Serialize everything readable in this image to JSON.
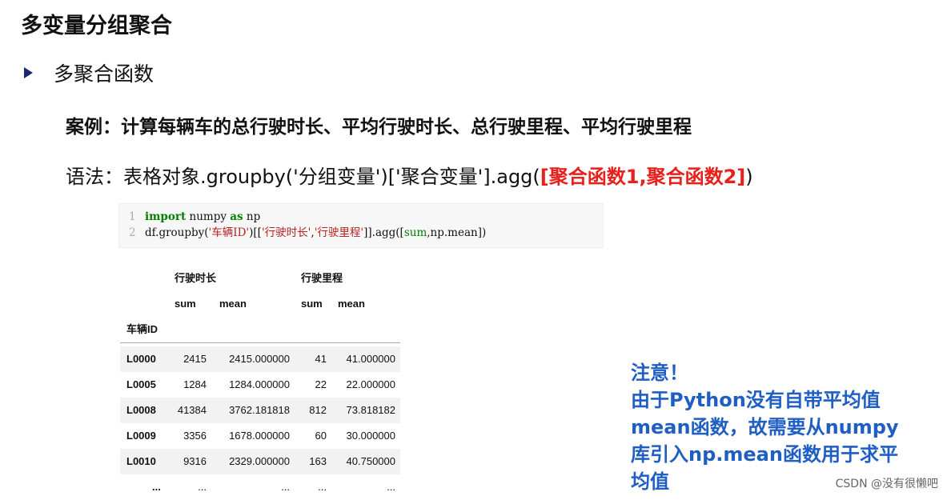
{
  "title": "多变量分组聚合",
  "bullet": "多聚合函数",
  "case_text": "案例：计算每辆车的总行驶时长、平均行驶时长、总行驶里程、平均行驶里程",
  "syntax": {
    "prefix": "语法：表格对象.groupby('分组变量')['聚合变量'].agg(",
    "highlight": "[聚合函数1,聚合函数2]",
    "suffix": ")"
  },
  "code": {
    "line1": {
      "num": "1",
      "kw_import": "import",
      "mid": " numpy ",
      "kw_as": "as",
      "end": " np"
    },
    "line2": {
      "num": "2",
      "p1": "df.groupby(",
      "s1": "'车辆ID'",
      "p2": ")[[",
      "s2": "'行驶时长'",
      "comma": ",",
      "s3": "'行驶里程'",
      "p3": "]].agg([",
      "b1": "sum",
      "p4": ",np.mean])"
    }
  },
  "table": {
    "group_headers": [
      "行驶时长",
      "行驶里程"
    ],
    "sub_headers": [
      "sum",
      "mean",
      "sum",
      "mean"
    ],
    "index_name": "车辆ID",
    "rows": [
      {
        "id": "L0000",
        "v": [
          "2415",
          "2415.000000",
          "41",
          "41.000000"
        ]
      },
      {
        "id": "L0005",
        "v": [
          "1284",
          "1284.000000",
          "22",
          "22.000000"
        ]
      },
      {
        "id": "L0008",
        "v": [
          "41384",
          "3762.181818",
          "812",
          "73.818182"
        ]
      },
      {
        "id": "L0009",
        "v": [
          "3356",
          "1678.000000",
          "60",
          "30.000000"
        ]
      },
      {
        "id": "L0010",
        "v": [
          "9316",
          "2329.000000",
          "163",
          "40.750000"
        ]
      }
    ],
    "ellipsis": "..."
  },
  "note": {
    "lines": [
      "注意！",
      "由于Python没有自带平均值",
      "mean函数，故需要从numpy",
      "库引入np.mean函数用于求平",
      "均值"
    ]
  },
  "watermark": "CSDN @没有很懒吧"
}
